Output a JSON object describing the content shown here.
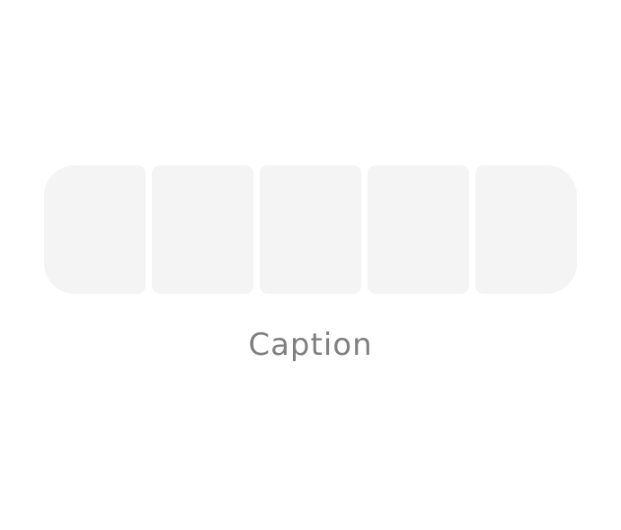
{
  "placeholder": {
    "caption": "Caption"
  },
  "colors": {
    "segment_fill": "#f4f4f4",
    "caption_text": "#7f7f7f",
    "background": "#ffffff"
  }
}
